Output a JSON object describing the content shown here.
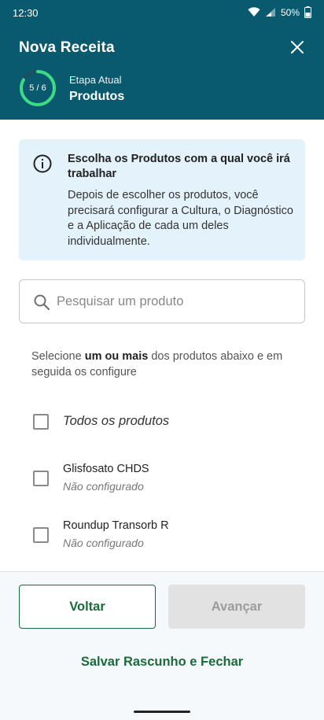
{
  "status_bar": {
    "time": "12:30",
    "battery": "50%",
    "icons": [
      "wifi-icon",
      "signal-icon",
      "battery-icon"
    ]
  },
  "header": {
    "title": "Nova Receita",
    "close_icon": "close-icon",
    "progress": {
      "label": "5 / 6",
      "current": 5,
      "total": 6
    },
    "step_label": "Etapa Atual",
    "step_value": "Produtos"
  },
  "info": {
    "icon": "info-icon",
    "title": "Escolha os Produtos com a qual você irá trabalhar",
    "body": "Depois de escolher os produtos, você precisará configurar a Cultura, o Diagnóstico e a Aplicação de cada um deles individualmente."
  },
  "search": {
    "icon": "search-icon",
    "placeholder": "Pesquisar um produto",
    "value": ""
  },
  "instruction": {
    "prefix": "Selecione ",
    "bold": "um ou mais",
    "suffix": " dos produtos abaixo e em seguida os configure"
  },
  "select_all": {
    "label": "Todos os produtos",
    "checked": false
  },
  "products": [
    {
      "name": "Glisfosato CHDS",
      "status": "Não configurado",
      "checked": false
    },
    {
      "name": "Roundup Transorb R",
      "status": "Não configurado",
      "checked": false
    }
  ],
  "footer": {
    "back_label": "Voltar",
    "next_label": "Avançar",
    "next_enabled": false,
    "save_label": "Salvar Rascunho e Fechar"
  },
  "colors": {
    "header_bg": "#0a5a6f",
    "progress_accent": "#3ddc84",
    "primary_green": "#1a6b3a",
    "info_bg": "#e4f2fc",
    "disabled_bg": "#e2e2e2"
  }
}
